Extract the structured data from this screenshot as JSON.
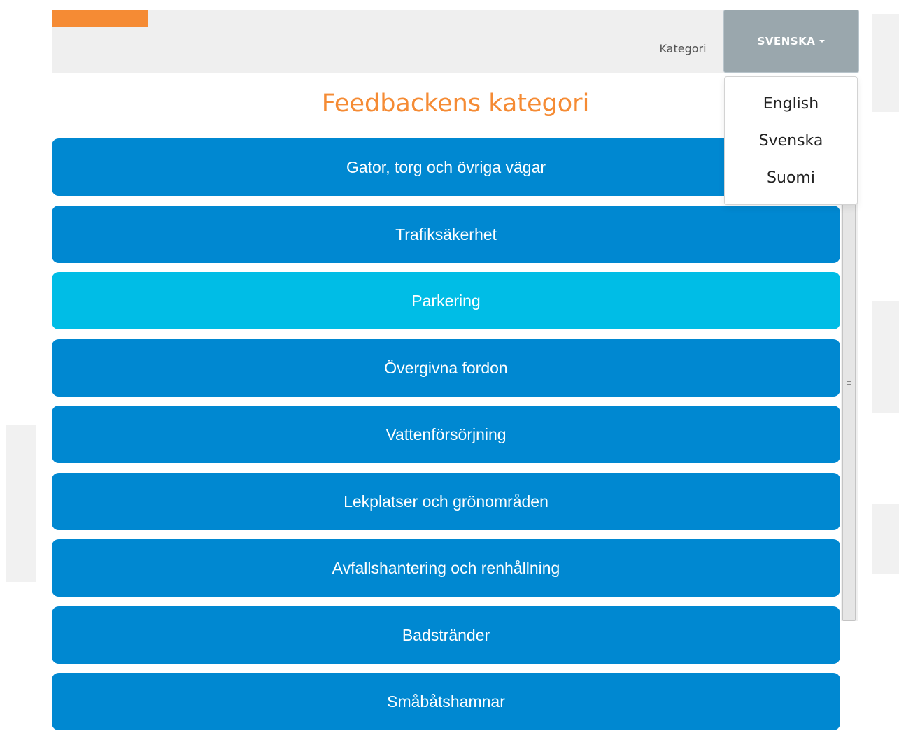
{
  "header": {
    "nav_link": "Kategori",
    "language_button": "SVENSKA",
    "logo_color": "#f58b34"
  },
  "language_menu": {
    "items": [
      "English",
      "Svenska",
      "Suomi"
    ]
  },
  "page": {
    "title": "Feedbackens kategori",
    "title_color": "#f58b34"
  },
  "categories": [
    {
      "label": "Gator, torg och övriga vägar",
      "active": false
    },
    {
      "label": "Trafiksäkerhet",
      "active": false
    },
    {
      "label": "Parkering",
      "active": true
    },
    {
      "label": "Övergivna fordon",
      "active": false
    },
    {
      "label": "Vattenförsörjning",
      "active": false
    },
    {
      "label": "Lekplatser och grönområden",
      "active": false
    },
    {
      "label": "Avfallshantering och renhållning",
      "active": false
    },
    {
      "label": "Badstränder",
      "active": false
    },
    {
      "label": "Småbåtshamnar",
      "active": false
    }
  ],
  "colors": {
    "category_button": "#0088d1",
    "category_button_active": "#00bde6",
    "language_button": "#9aa7ad",
    "header_background": "#efefef"
  }
}
